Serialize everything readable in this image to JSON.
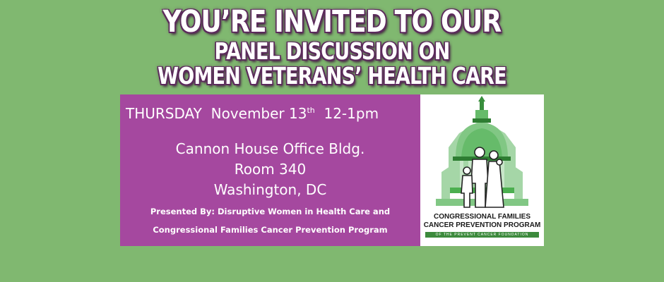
{
  "headline": {
    "line1": "YOU’RE INVITED TO OUR",
    "line2": "PANEL DISCUSSION ON",
    "line3": "WOMEN VETERANS’ HEALTH CARE"
  },
  "event": {
    "day": "THURSDAY",
    "date": "November 13",
    "date_suffix": "th",
    "time": "12-1pm",
    "venue": "Cannon House Office Bldg.",
    "room": "Room 340",
    "city": "Washington, DC",
    "presented_line1": "Presented By: Disruptive Women in Health Care and",
    "presented_line2": "Congressional Families Cancer Prevention Program"
  },
  "logo": {
    "line1": "CONGRESSIONAL FAMILIES",
    "line2": "CANCER PREVENTION PROGRAM",
    "tagline": "OF THE PREVENT CANCER FOUNDATION",
    "icon": "capitol-dome-family-icon"
  },
  "colors": {
    "background": "#80b870",
    "panel": "#a5489f",
    "logo_green": "#4caf50"
  }
}
